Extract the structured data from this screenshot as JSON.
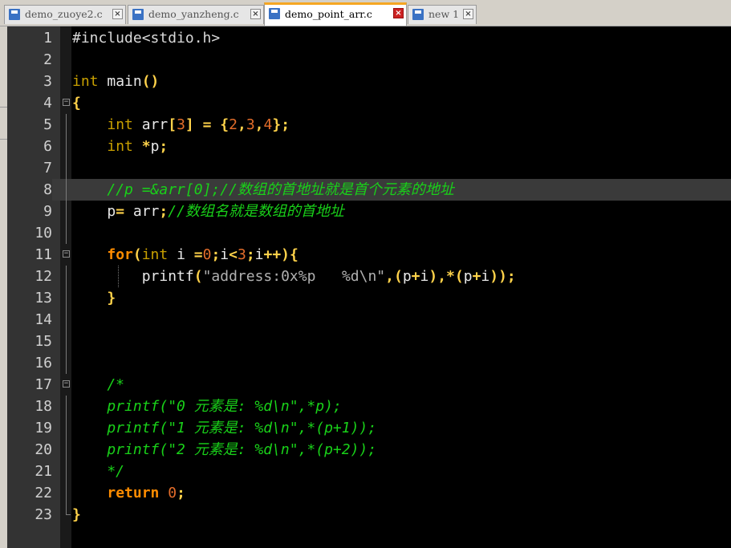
{
  "tabs": [
    {
      "label": "demo_zuoye2.c",
      "active": false
    },
    {
      "label": "demo_yanzheng.c",
      "active": false
    },
    {
      "label": "demo_point_arr.c",
      "active": true
    },
    {
      "label": "new 1",
      "active": false
    }
  ],
  "editor": {
    "current_line": 8,
    "lines": [
      {
        "n": "1",
        "tokens": [
          {
            "t": "#include<stdio.h>",
            "c": "pre"
          }
        ]
      },
      {
        "n": "2",
        "tokens": []
      },
      {
        "n": "3",
        "tokens": [
          {
            "t": "int",
            "c": "kw"
          },
          {
            "t": " main",
            "c": "id"
          },
          {
            "t": "()",
            "c": "op"
          }
        ]
      },
      {
        "n": "4",
        "tokens": [
          {
            "t": "{",
            "c": "op"
          }
        ]
      },
      {
        "n": "5",
        "tokens": [
          {
            "t": "    ",
            "c": "id"
          },
          {
            "t": "int",
            "c": "kw"
          },
          {
            "t": " arr",
            "c": "id"
          },
          {
            "t": "[",
            "c": "op"
          },
          {
            "t": "3",
            "c": "num"
          },
          {
            "t": "]",
            "c": "op"
          },
          {
            "t": " ",
            "c": "id"
          },
          {
            "t": "=",
            "c": "op"
          },
          {
            "t": " ",
            "c": "id"
          },
          {
            "t": "{",
            "c": "op"
          },
          {
            "t": "2",
            "c": "num"
          },
          {
            "t": ",",
            "c": "op"
          },
          {
            "t": "3",
            "c": "num"
          },
          {
            "t": ",",
            "c": "op"
          },
          {
            "t": "4",
            "c": "num"
          },
          {
            "t": "};",
            "c": "op"
          }
        ]
      },
      {
        "n": "6",
        "tokens": [
          {
            "t": "    ",
            "c": "id"
          },
          {
            "t": "int",
            "c": "kw"
          },
          {
            "t": " ",
            "c": "id"
          },
          {
            "t": "*",
            "c": "op"
          },
          {
            "t": "p",
            "c": "id"
          },
          {
            "t": ";",
            "c": "op"
          }
        ]
      },
      {
        "n": "7",
        "tokens": []
      },
      {
        "n": "8",
        "tokens": [
          {
            "t": "    ",
            "c": "id"
          },
          {
            "t": "//p =&arr[0];//数组的首地址就是首个元素的地址",
            "c": "cm"
          }
        ]
      },
      {
        "n": "9",
        "tokens": [
          {
            "t": "    p",
            "c": "id"
          },
          {
            "t": "=",
            "c": "op"
          },
          {
            "t": " arr",
            "c": "id"
          },
          {
            "t": ";",
            "c": "op"
          },
          {
            "t": "//数组名就是数组的首地址",
            "c": "cm"
          }
        ]
      },
      {
        "n": "10",
        "tokens": []
      },
      {
        "n": "11",
        "tokens": [
          {
            "t": "    ",
            "c": "id"
          },
          {
            "t": "for",
            "c": "ret"
          },
          {
            "t": "(",
            "c": "op"
          },
          {
            "t": "int",
            "c": "kw"
          },
          {
            "t": " i ",
            "c": "id"
          },
          {
            "t": "=",
            "c": "op"
          },
          {
            "t": "0",
            "c": "num"
          },
          {
            "t": ";",
            "c": "op"
          },
          {
            "t": "i",
            "c": "id"
          },
          {
            "t": "<",
            "c": "op"
          },
          {
            "t": "3",
            "c": "num"
          },
          {
            "t": ";",
            "c": "op"
          },
          {
            "t": "i",
            "c": "id"
          },
          {
            "t": "++){",
            "c": "op"
          }
        ]
      },
      {
        "n": "12",
        "tokens": [
          {
            "t": "        printf",
            "c": "id"
          },
          {
            "t": "(",
            "c": "op"
          },
          {
            "t": "\"address:0x%p   %d\\n\"",
            "c": "str"
          },
          {
            "t": ",(",
            "c": "op"
          },
          {
            "t": "p",
            "c": "id"
          },
          {
            "t": "+",
            "c": "op"
          },
          {
            "t": "i",
            "c": "id"
          },
          {
            "t": "),*(",
            "c": "op"
          },
          {
            "t": "p",
            "c": "id"
          },
          {
            "t": "+",
            "c": "op"
          },
          {
            "t": "i",
            "c": "id"
          },
          {
            "t": "));",
            "c": "op"
          }
        ]
      },
      {
        "n": "13",
        "tokens": [
          {
            "t": "    ",
            "c": "id"
          },
          {
            "t": "}",
            "c": "op"
          }
        ]
      },
      {
        "n": "14",
        "tokens": []
      },
      {
        "n": "15",
        "tokens": []
      },
      {
        "n": "16",
        "tokens": []
      },
      {
        "n": "17",
        "tokens": [
          {
            "t": "    /*",
            "c": "cm"
          }
        ]
      },
      {
        "n": "18",
        "tokens": [
          {
            "t": "    printf(\"0 元素是: %d\\n\",*p);",
            "c": "cm"
          }
        ]
      },
      {
        "n": "19",
        "tokens": [
          {
            "t": "    printf(\"1 元素是: %d\\n\",*(p+1));",
            "c": "cm"
          }
        ]
      },
      {
        "n": "20",
        "tokens": [
          {
            "t": "    printf(\"2 元素是: %d\\n\",*(p+2));",
            "c": "cm"
          }
        ]
      },
      {
        "n": "21",
        "tokens": [
          {
            "t": "    */",
            "c": "cm"
          }
        ]
      },
      {
        "n": "22",
        "tokens": [
          {
            "t": "    ",
            "c": "id"
          },
          {
            "t": "return",
            "c": "ret"
          },
          {
            "t": " ",
            "c": "id"
          },
          {
            "t": "0",
            "c": "num"
          },
          {
            "t": ";",
            "c": "op"
          }
        ]
      },
      {
        "n": "23",
        "tokens": [
          {
            "t": "}",
            "c": "op"
          }
        ]
      }
    ],
    "fold_markers": {
      "4": "minus",
      "11": "minus",
      "17": "minus",
      "23": "end"
    },
    "fold_lines": [
      5,
      6,
      7,
      8,
      9,
      10,
      11,
      12,
      13,
      14,
      15,
      16,
      17,
      18,
      19,
      20,
      21,
      22
    ],
    "indent_guide_lines": [
      12
    ]
  },
  "colors": {
    "accent_tab": "#f5a623",
    "background": "#000000",
    "comment": "#19d119"
  }
}
